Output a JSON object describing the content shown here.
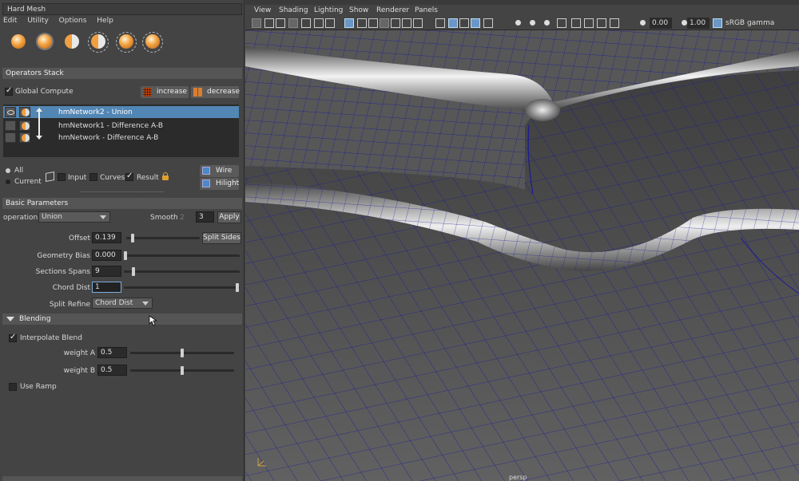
{
  "window": {
    "title": "Hard Mesh"
  },
  "menu": [
    "Edit",
    "Utility",
    "Options",
    "Help"
  ],
  "tools": [
    {
      "icon": "sphere-icon"
    },
    {
      "icon": "sphere-ring-icon"
    },
    {
      "icon": "half-sphere-icon"
    },
    {
      "icon": "half-sphere-ring-icon"
    },
    {
      "icon": "sphere-dashed-icon"
    },
    {
      "icon": "sphere-dashed-alt-icon"
    }
  ],
  "operators": {
    "title": "Operators Stack",
    "global_compute": "Global Compute",
    "increase": "increase",
    "decrease": "decrease",
    "items": [
      {
        "name": "hmNetwork2 - Union",
        "selected": true
      },
      {
        "name": "hmNetwork1 - Difference A-B",
        "selected": false
      },
      {
        "name": "hmNetwork - Difference A-B",
        "selected": false
      }
    ]
  },
  "display": {
    "all": "All",
    "current": "Current",
    "input": "Input",
    "curves": "Curves",
    "result": "Result",
    "wire": "Wire",
    "hilight": "Hilight"
  },
  "basic": {
    "title": "Basic Parameters",
    "operation_label": "operation",
    "operation_value": "Union",
    "smooth_label": "Smooth",
    "smooth_hint": "2",
    "smooth_value": "3",
    "apply": "Apply",
    "offset_label": "Offset",
    "offset_value": "0.139",
    "offset_level": 0.139,
    "split_sides": "Split Sides",
    "geometry_bias_label": "Geometry Bias",
    "geometry_bias_value": "0.000",
    "geometry_bias_level": 0.0,
    "sections_spans_label": "Sections Spans",
    "sections_spans_value": "9",
    "chord_dist_label": "Chord Dist",
    "chord_dist_value": "1",
    "split_refine_label": "Split Refine",
    "split_refine_value": "Chord Dist"
  },
  "blending": {
    "title": "Blending",
    "interpolate": "Interpolate Blend",
    "weight_a_label": "weight A",
    "weight_a_value": "0.5",
    "weight_b_label": "weight B",
    "weight_b_value": "0.5",
    "use_ramp": "Use Ramp"
  },
  "viewport": {
    "menu": [
      "View",
      "Shading",
      "Lighting",
      "Show",
      "Renderer",
      "Panels"
    ],
    "exposure": "0.00",
    "gamma": "1.00",
    "colorspace": "sRGB gamma",
    "camera": "persp",
    "colors": {
      "mesh": "#8a8a8a",
      "wire": "#1a1a9a",
      "highlight": "#f4f4f4"
    }
  }
}
